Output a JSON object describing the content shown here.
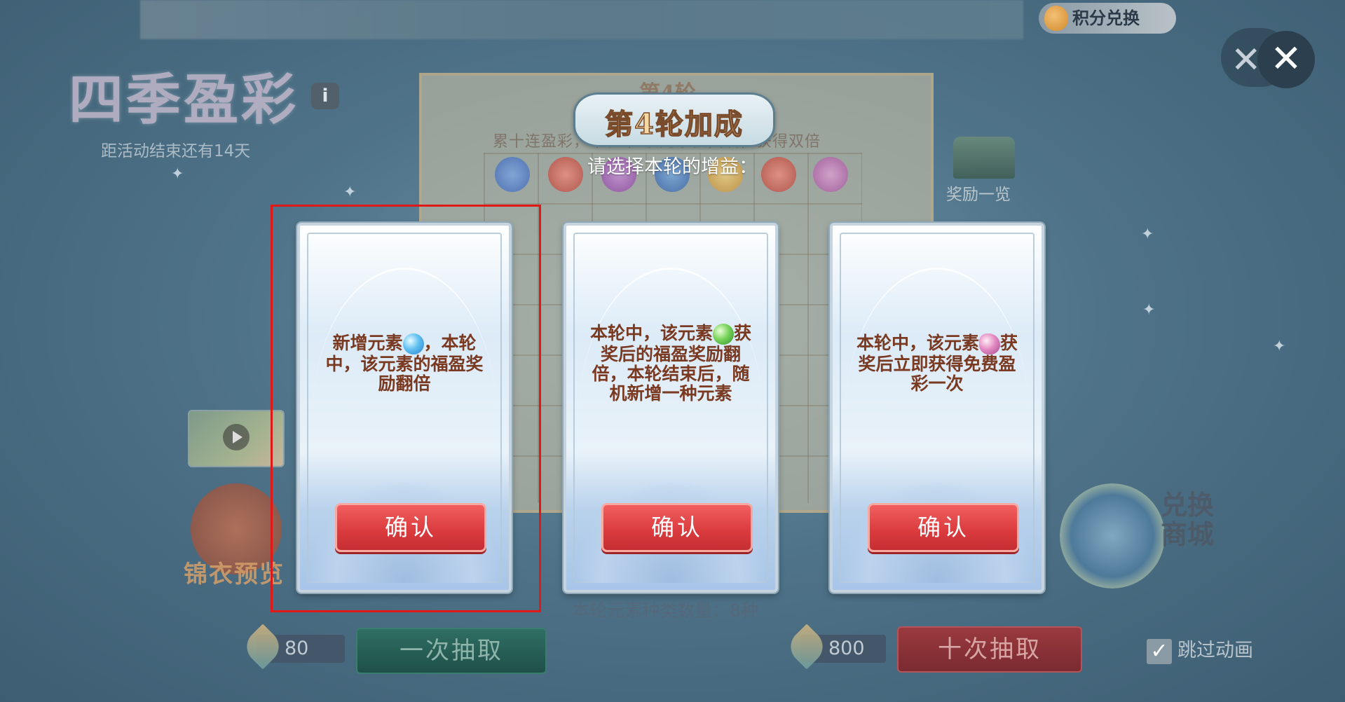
{
  "header": {
    "event_title": "四季盈彩",
    "info_label": "i",
    "countdown": "距活动结束还有14天",
    "points_exchange": "积分兑换",
    "close_label": "✕"
  },
  "board": {
    "round_title": "第4轮",
    "note": "累十连盈彩，本轮中 该元素获奖后，获得双倍",
    "element_count": "本轮元素种类数量：8种"
  },
  "side": {
    "reward_list": "奖励一览",
    "outfit_preview": "锦衣预览",
    "exchange_shop": "兑换商城"
  },
  "footer": {
    "cost_once": "80",
    "draw_once": "一次抽取",
    "cost_ten": "800",
    "draw_ten": "十次抽取",
    "skip_animation": "跳过动画",
    "skip_checked": true
  },
  "modal": {
    "banner": "第4轮加成",
    "subtitle": "请选择本轮的增益：",
    "cards": [
      {
        "text_before": "新增元素",
        "element": "blue-gem-icon",
        "text_after": "，本轮中，该元素的福盈奖励翻倍",
        "confirm": "确认",
        "selected": true
      },
      {
        "text_before": "本轮中，该元素",
        "element": "green-gem-icon",
        "text_after": "获奖后的福盈奖励翻倍，本轮结束后，随机新增一种元素",
        "confirm": "确认",
        "selected": false
      },
      {
        "text_before": "本轮中，该元素",
        "element": "pink-gem-icon",
        "text_after": "获奖后立即获得免费盈彩一次",
        "confirm": "确认",
        "selected": false
      }
    ]
  },
  "colors": {
    "confirm_red": "#d93a3d",
    "card_text": "#7a3a22",
    "selection_outline": "#e01818"
  }
}
